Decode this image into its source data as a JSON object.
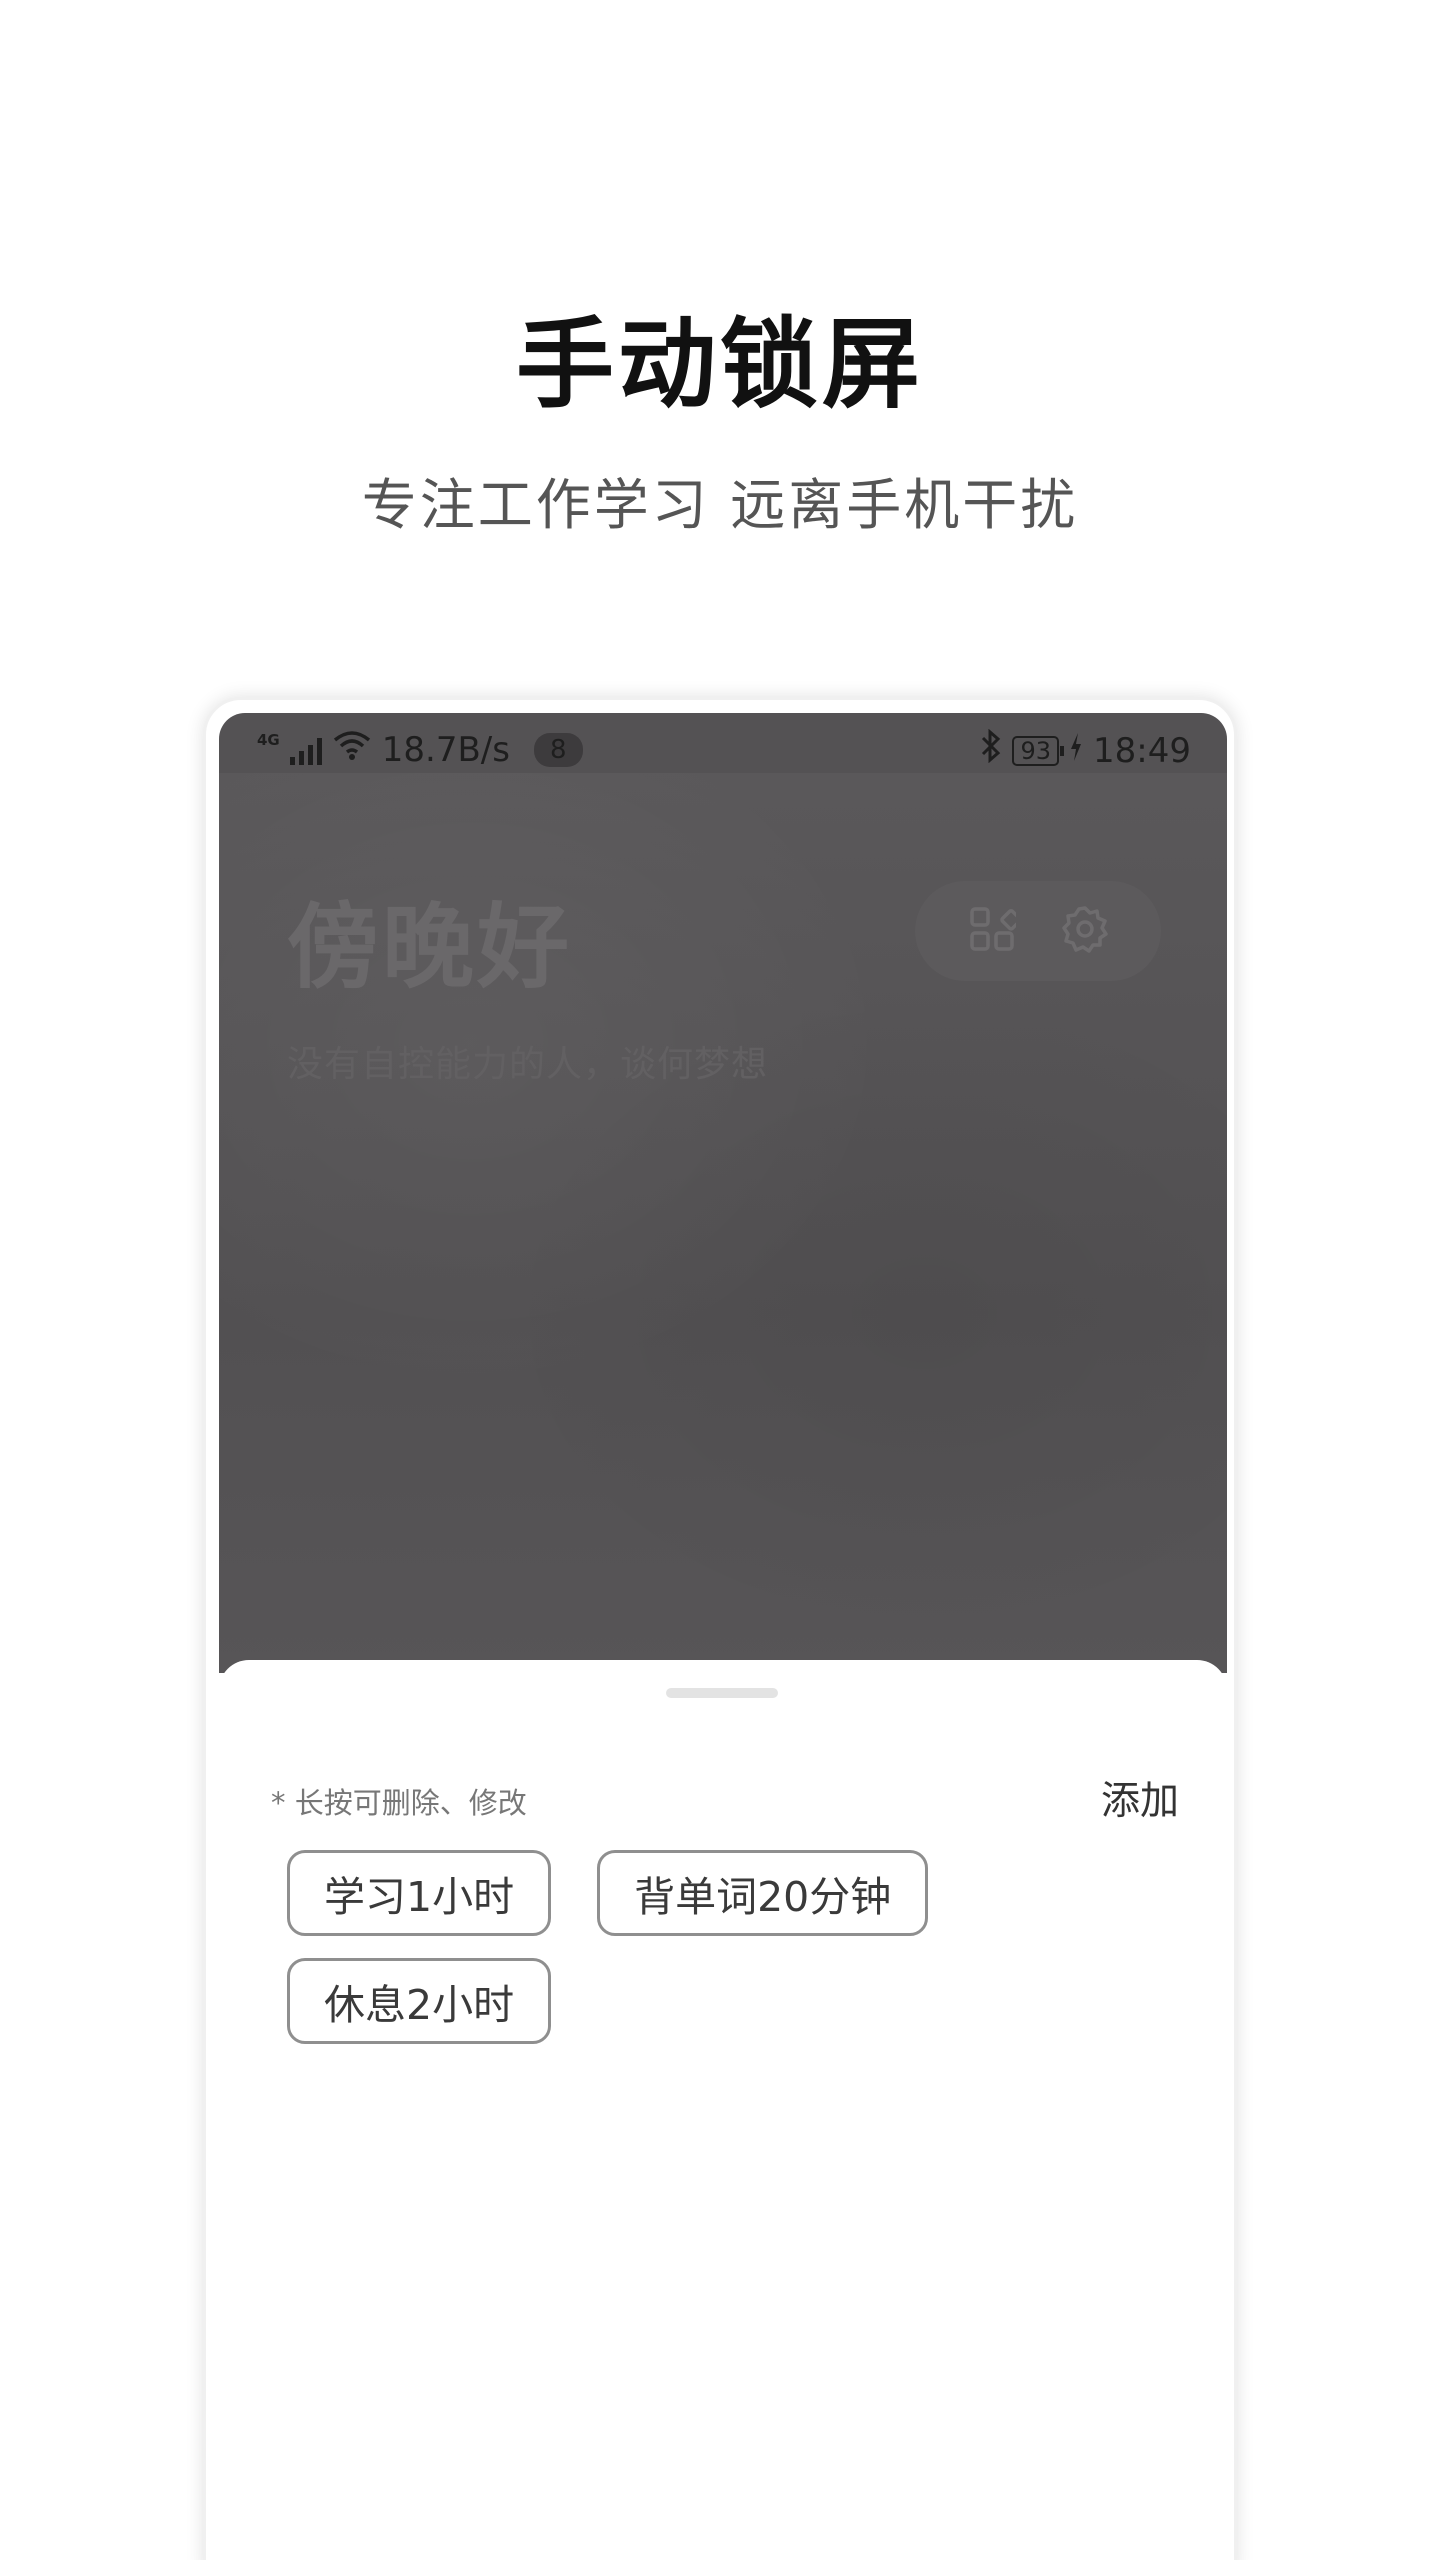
{
  "hero": {
    "title": "手动锁屏",
    "subtitle": "专注工作学习 远离手机干扰"
  },
  "status_bar": {
    "network": "4G",
    "speed": "18.7B/s",
    "notifications": "8",
    "battery": "93",
    "time": "18:49",
    "icons": [
      "signal-icon",
      "wifi-icon",
      "bluetooth-icon",
      "battery-icon",
      "charging-icon"
    ]
  },
  "home": {
    "greeting": "傍晚好",
    "motto": "没有自控能力的人，谈何梦想",
    "actions": [
      {
        "icon": "apps-grid-icon"
      },
      {
        "icon": "gear-icon"
      }
    ]
  },
  "sheet": {
    "hint": "* 长按可删除、修改",
    "add_label": "添加",
    "presets": [
      {
        "label": "学习1小时"
      },
      {
        "label": "背单词20分钟"
      },
      {
        "label": "休息2小时"
      }
    ]
  },
  "colors": {
    "overlay": "#545254",
    "sheet_bg": "#ffffff",
    "tag_border": "#8f8f8f",
    "title": "#111111"
  }
}
